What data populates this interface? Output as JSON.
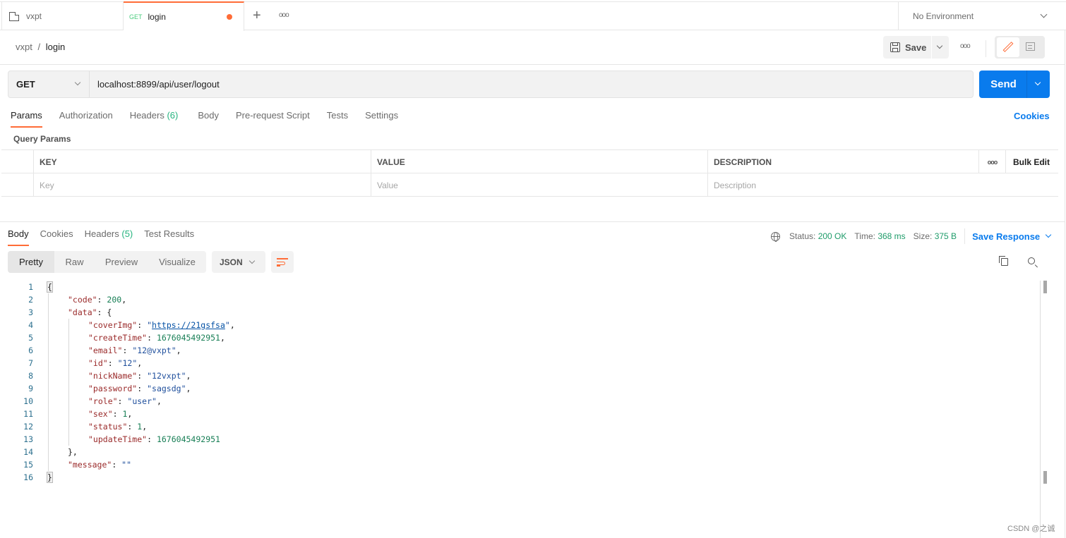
{
  "tabs": [
    {
      "icon": "collection-file-icon",
      "label": "vxpt"
    },
    {
      "method": "GET",
      "label": "login",
      "unsaved": true
    }
  ],
  "tab_actions": {
    "add": "+",
    "more": "ooo"
  },
  "environment": {
    "selected": "No Environment"
  },
  "breadcrumb": {
    "parent": "vxpt",
    "separator": "/",
    "current": "login"
  },
  "toolbar": {
    "save_label": "Save",
    "more": "ooo"
  },
  "request": {
    "method": "GET",
    "url": "localhost:8899/api/user/logout",
    "send_label": "Send"
  },
  "request_tabs": [
    {
      "label": "Params",
      "active": true
    },
    {
      "label": "Authorization"
    },
    {
      "label": "Headers",
      "count": "(6)"
    },
    {
      "label": "Body"
    },
    {
      "label": "Pre-request Script"
    },
    {
      "label": "Tests"
    },
    {
      "label": "Settings"
    }
  ],
  "cookies_link": "Cookies",
  "query_params": {
    "title": "Query Params",
    "headers": [
      "KEY",
      "VALUE",
      "DESCRIPTION"
    ],
    "more": "ooo",
    "bulk_edit": "Bulk Edit",
    "placeholders": {
      "key": "Key",
      "value": "Value",
      "description": "Description"
    }
  },
  "response_tabs": [
    {
      "label": "Body",
      "active": true
    },
    {
      "label": "Cookies"
    },
    {
      "label": "Headers",
      "count": "(5)"
    },
    {
      "label": "Test Results"
    }
  ],
  "response_status": {
    "status_label": "Status:",
    "status_value": "200 OK",
    "time_label": "Time:",
    "time_value": "368 ms",
    "size_label": "Size:",
    "size_value": "375 B",
    "save_response": "Save Response"
  },
  "view_modes": [
    "Pretty",
    "Raw",
    "Preview",
    "Visualize"
  ],
  "active_view": "Pretty",
  "format": "JSON",
  "colors": {
    "accent": "#ff6c37",
    "primary": "#097bed",
    "success": "#26b47f"
  },
  "response_body": [
    {
      "n": "1",
      "indent": 0,
      "tokens": [
        [
          "p",
          "{"
        ]
      ],
      "hl": true
    },
    {
      "n": "2",
      "indent": 1,
      "tokens": [
        [
          "k",
          "\"code\""
        ],
        [
          "p",
          ": "
        ],
        [
          "n",
          "200"
        ],
        [
          "p",
          ","
        ]
      ]
    },
    {
      "n": "3",
      "indent": 1,
      "tokens": [
        [
          "k",
          "\"data\""
        ],
        [
          "p",
          ": "
        ],
        [
          "p",
          "{"
        ]
      ]
    },
    {
      "n": "4",
      "indent": 2,
      "tokens": [
        [
          "k",
          "\"coverImg\""
        ],
        [
          "p",
          ": "
        ],
        [
          "s",
          "\""
        ],
        [
          "u",
          "https://21gsfsa"
        ],
        [
          "s",
          "\""
        ],
        [
          "p",
          ","
        ]
      ]
    },
    {
      "n": "5",
      "indent": 2,
      "tokens": [
        [
          "k",
          "\"createTime\""
        ],
        [
          "p",
          ": "
        ],
        [
          "n",
          "1676045492951"
        ],
        [
          "p",
          ","
        ]
      ]
    },
    {
      "n": "6",
      "indent": 2,
      "tokens": [
        [
          "k",
          "\"email\""
        ],
        [
          "p",
          ": "
        ],
        [
          "s",
          "\"12@vxpt\""
        ],
        [
          "p",
          ","
        ]
      ]
    },
    {
      "n": "7",
      "indent": 2,
      "tokens": [
        [
          "k",
          "\"id\""
        ],
        [
          "p",
          ": "
        ],
        [
          "s",
          "\"12\""
        ],
        [
          "p",
          ","
        ]
      ]
    },
    {
      "n": "8",
      "indent": 2,
      "tokens": [
        [
          "k",
          "\"nickName\""
        ],
        [
          "p",
          ": "
        ],
        [
          "s",
          "\"12vxpt\""
        ],
        [
          "p",
          ","
        ]
      ]
    },
    {
      "n": "9",
      "indent": 2,
      "tokens": [
        [
          "k",
          "\"password\""
        ],
        [
          "p",
          ": "
        ],
        [
          "s",
          "\"sagsdg\""
        ],
        [
          "p",
          ","
        ]
      ]
    },
    {
      "n": "10",
      "indent": 2,
      "tokens": [
        [
          "k",
          "\"role\""
        ],
        [
          "p",
          ": "
        ],
        [
          "s",
          "\"user\""
        ],
        [
          "p",
          ","
        ]
      ]
    },
    {
      "n": "11",
      "indent": 2,
      "tokens": [
        [
          "k",
          "\"sex\""
        ],
        [
          "p",
          ": "
        ],
        [
          "n",
          "1"
        ],
        [
          "p",
          ","
        ]
      ]
    },
    {
      "n": "12",
      "indent": 2,
      "tokens": [
        [
          "k",
          "\"status\""
        ],
        [
          "p",
          ": "
        ],
        [
          "n",
          "1"
        ],
        [
          "p",
          ","
        ]
      ]
    },
    {
      "n": "13",
      "indent": 2,
      "tokens": [
        [
          "k",
          "\"updateTime\""
        ],
        [
          "p",
          ": "
        ],
        [
          "n",
          "1676045492951"
        ]
      ]
    },
    {
      "n": "14",
      "indent": 1,
      "tokens": [
        [
          "p",
          "},"
        ]
      ]
    },
    {
      "n": "15",
      "indent": 1,
      "tokens": [
        [
          "k",
          "\"message\""
        ],
        [
          "p",
          ": "
        ],
        [
          "s",
          "\"\""
        ]
      ]
    },
    {
      "n": "16",
      "indent": 0,
      "tokens": [
        [
          "p",
          "}"
        ]
      ],
      "hl": true
    }
  ],
  "watermark": "CSDN @之诚"
}
